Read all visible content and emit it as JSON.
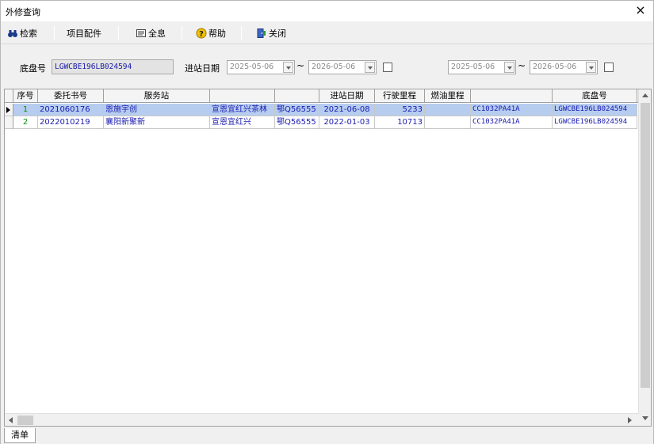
{
  "window": {
    "title": "外修查询",
    "close_label": "×"
  },
  "toolbar": {
    "search_label": "检索",
    "parts_label": "项目配件",
    "full_info_label": "全息",
    "help_label": "帮助",
    "close_label": "关闭"
  },
  "filter": {
    "chassis_label": "底盘号",
    "chassis_value": "LGWCBE196LB024594",
    "entry_date_label": "进站日期",
    "date_from_1": "2025-05-06",
    "date_to_1": "2026-05-06",
    "date_from_2": "2025-05-06",
    "date_to_2": "2026-05-06",
    "tilde": "~"
  },
  "grid": {
    "columns": [
      "序号",
      "委托书号",
      "服务站",
      "",
      "",
      "进站日期",
      "行驶里程",
      "燃油里程",
      "",
      "底盘号"
    ],
    "rows": [
      {
        "seq": "1",
        "order_no": "2021060176",
        "station": "恩施宇创",
        "customer": "宣恩宜红兴茶林",
        "plate": "鄂Q56555",
        "entry_date": "2021-06-08",
        "mileage": "5233",
        "fuel_mileage": "",
        "model": "CC1032PA41A",
        "chassis": "LGWCBE196LB024594"
      },
      {
        "seq": "2",
        "order_no": "2022010219",
        "station": "襄阳新聚新",
        "customer": "宣恩宜红兴",
        "plate": "鄂Q56555",
        "entry_date": "2022-01-03",
        "mileage": "10713",
        "fuel_mileage": "",
        "model": "CC1032PA41A",
        "chassis": "LGWCBE196LB024594"
      }
    ]
  },
  "tabs": {
    "list_label": "清单"
  },
  "colors": {
    "selection": "#b6cdf0",
    "seq_green": "#009000",
    "text_blue": "#1a1ab0"
  }
}
